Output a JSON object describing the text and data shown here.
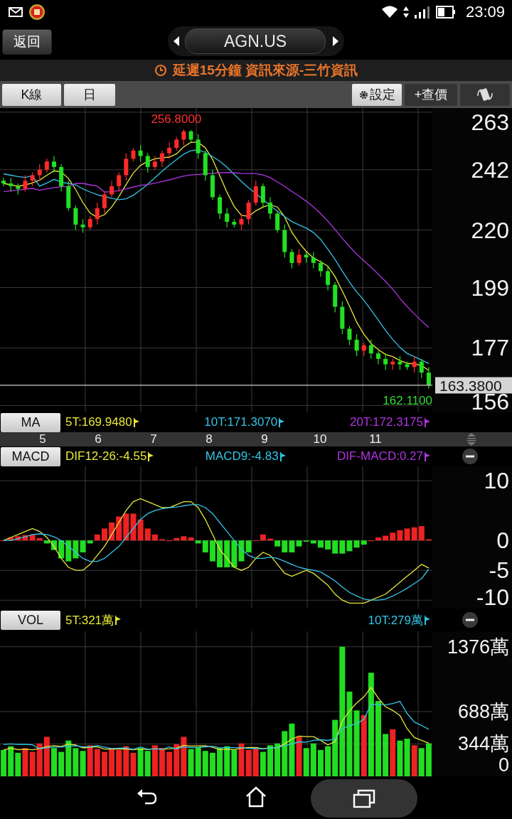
{
  "status_bar": {
    "time": "23:09"
  },
  "header": {
    "back_button": "返回",
    "symbol": "AGN.US"
  },
  "notice": "延遲15分鐘 資訊來源-三竹資訊",
  "toolbar": {
    "chips": [
      "K線",
      "日"
    ],
    "settings": "設定",
    "quote": "+查價"
  },
  "price_chart": {
    "high_label": "256.8000",
    "low_label": "162.1100",
    "chart_data": {
      "type": "candlestick",
      "ylim": [
        153.5,
        264.5
      ],
      "yticks": [
        263,
        242,
        220,
        199,
        177,
        156
      ],
      "grid": true,
      "ref_lines": [
        {
          "axis": "y",
          "value": 163.38,
          "label": "163.3800"
        }
      ],
      "ohlc": [
        [
          238,
          239,
          236,
          237
        ],
        [
          237,
          239,
          234,
          236
        ],
        [
          236,
          237,
          233,
          235
        ],
        [
          235,
          240,
          234,
          238
        ],
        [
          238,
          241,
          236,
          240
        ],
        [
          240,
          244,
          238,
          242
        ],
        [
          242,
          246,
          241,
          245
        ],
        [
          245,
          247,
          241,
          243
        ],
        [
          243,
          244,
          234,
          236
        ],
        [
          236,
          238,
          227,
          228
        ],
        [
          228,
          229,
          220,
          222
        ],
        [
          222,
          224,
          219,
          221
        ],
        [
          221,
          225,
          220,
          224
        ],
        [
          224,
          230,
          222,
          228
        ],
        [
          228,
          234,
          226,
          233
        ],
        [
          233,
          238,
          232,
          236
        ],
        [
          236,
          241,
          234,
          240
        ],
        [
          240,
          248,
          238,
          246
        ],
        [
          246,
          250,
          245,
          249
        ],
        [
          249,
          251,
          245,
          247
        ],
        [
          247,
          248,
          241,
          243
        ],
        [
          243,
          247,
          242,
          245
        ],
        [
          245,
          249,
          243,
          248
        ],
        [
          248,
          252,
          246,
          250
        ],
        [
          250,
          254,
          249,
          253
        ],
        [
          253,
          256.8,
          251,
          256
        ],
        [
          256,
          256.5,
          252,
          253
        ],
        [
          253,
          255,
          246,
          248
        ],
        [
          248,
          249,
          238,
          240
        ],
        [
          240,
          242,
          231,
          232
        ],
        [
          232,
          233,
          224,
          226
        ],
        [
          226,
          228,
          221,
          223
        ],
        [
          223,
          224,
          221,
          222
        ],
        [
          222,
          226,
          220,
          224
        ],
        [
          224,
          231,
          222,
          230
        ],
        [
          230,
          238,
          229,
          236
        ],
        [
          236,
          237,
          228,
          230
        ],
        [
          230,
          232,
          224,
          226
        ],
        [
          226,
          227,
          219,
          220
        ],
        [
          220,
          222,
          210,
          212
        ],
        [
          212,
          213,
          206,
          208
        ],
        [
          208,
          213,
          207,
          211
        ],
        [
          211,
          212,
          208,
          210
        ],
        [
          210,
          212,
          206,
          208
        ],
        [
          208,
          209,
          203,
          205
        ],
        [
          205,
          207,
          198,
          200
        ],
        [
          200,
          201,
          190,
          192
        ],
        [
          192,
          194,
          182,
          184
        ],
        [
          184,
          185,
          178,
          180
        ],
        [
          180,
          182,
          174,
          176
        ],
        [
          176,
          179,
          174,
          178
        ],
        [
          178,
          180,
          173,
          175
        ],
        [
          175,
          176,
          171,
          173
        ],
        [
          173,
          175,
          169,
          171
        ],
        [
          171,
          173,
          169,
          172
        ],
        [
          172,
          174,
          169,
          171
        ],
        [
          171,
          172,
          169,
          170
        ],
        [
          170,
          174,
          168,
          172
        ],
        [
          172,
          173,
          166,
          168
        ],
        [
          168,
          170,
          162.11,
          163.38
        ]
      ],
      "series": [
        {
          "name": "5T",
          "type": "line",
          "color": "#e8e83a",
          "values": [
            237,
            236.5,
            236,
            236.5,
            237.2,
            238.2,
            240,
            241.6,
            241.2,
            238.8,
            234.8,
            230,
            226.2,
            224.6,
            225.6,
            228.4,
            232.2,
            236.6,
            240.8,
            243.6,
            245,
            246,
            246.4,
            246.6,
            247.8,
            250.4,
            252,
            252,
            250,
            245.8,
            239.8,
            233.8,
            228.6,
            225.4,
            225,
            227,
            228.4,
            229.2,
            228.4,
            224.8,
            219.2,
            215.4,
            212.2,
            209.8,
            208.4,
            206.8,
            203,
            197.8,
            192.2,
            186.4,
            182,
            178.6,
            176.4,
            174.6,
            173.8,
            172.4,
            171.4,
            171.2,
            170.6,
            168.8
          ]
        },
        {
          "name": "10T",
          "type": "line",
          "color": "#33c4e6",
          "values": [
            240.5,
            240,
            239.5,
            239.2,
            239.8,
            236,
            237.2,
            238.5,
            237.5,
            237,
            236.5,
            235,
            233.9,
            232.9,
            232.2,
            231.6,
            231.1,
            231.4,
            232.7,
            234.6,
            236.7,
            239.1,
            241.5,
            243.7,
            245.7,
            247.7,
            249,
            249.2,
            248.3,
            246.8,
            245.1,
            242.9,
            240.3,
            237.7,
            235.4,
            233.4,
            231.1,
            228.9,
            226.9,
            224.9,
            223.1,
            221.9,
            220.7,
            219.1,
            216.6,
            213,
            209.2,
            205,
            201,
            197.4,
            194.4,
            190.8,
            187.1,
            183.4,
            180.1,
            177.2,
            175,
            173.8,
            172.6,
            171.3
          ]
        },
        {
          "name": "20T",
          "type": "line",
          "color": "#b034e0",
          "values": [
            234,
            234.3,
            234.6,
            234.9,
            235.2,
            234.5,
            235,
            235.5,
            235.8,
            235.9,
            237,
            237,
            236.5,
            236,
            233.9,
            234,
            234.4,
            235,
            235.7,
            236.3,
            236.6,
            237.1,
            237.7,
            238.3,
            239,
            239.7,
            240.1,
            240.3,
            240.5,
            240.7,
            240.9,
            241,
            240.9,
            240.7,
            240.6,
            240.6,
            240.1,
            239.1,
            237.6,
            235.9,
            234.1,
            232.4,
            230.5,
            228.4,
            226,
            223.2,
            220.2,
            217,
            214,
            211.2,
            208.8,
            206.4,
            203.9,
            201.3,
            198.4,
            195.1,
            192.1,
            189.4,
            186.8,
            184.5
          ]
        }
      ]
    }
  },
  "ma_legend": {
    "button": "MA",
    "values": [
      ":169.9480",
      ":171.3070",
      ":172.3175"
    ]
  },
  "date_axis": [
    "5",
    "6",
    "7",
    "8",
    "9",
    "10",
    "11"
  ],
  "macd": {
    "button": "MACD",
    "legend": [
      {
        "value": ":-4.55"
      },
      {
        "value": ":-4.83"
      },
      {
        "value": ":0.27",
        "color": "#b034e0"
      }
    ],
    "chart_data": {
      "type": "line",
      "ylim": [
        -11.4,
        12.4
      ],
      "yticks": [
        10,
        0,
        -5,
        -10
      ],
      "grid": true,
      "series": [
        {
          "name": "DIF12-26",
          "color": "#e8e83a",
          "values": [
            0,
            0.5,
            1,
            1.5,
            2,
            1.5,
            0.5,
            -1,
            -3,
            -4.5,
            -5,
            -5,
            -4,
            -2.5,
            -1,
            1,
            3,
            5,
            6.5,
            7,
            6.5,
            6,
            5.5,
            5.5,
            6,
            6.5,
            6.5,
            5.5,
            3.5,
            1,
            -1.5,
            -3,
            -4.5,
            -5,
            -4.5,
            -3,
            -2,
            -2.5,
            -4,
            -5.5,
            -6,
            -5.5,
            -5,
            -5.5,
            -6.5,
            -7.5,
            -9,
            -10,
            -10.5,
            -10.5,
            -10.5,
            -10,
            -9.5,
            -9,
            -8,
            -7,
            -6,
            -5,
            -4,
            -4.6
          ]
        },
        {
          "name": "MACD9",
          "color": "#33c4e6",
          "values": [
            0,
            0,
            0.3,
            0.6,
            1,
            1.1,
            1,
            0.6,
            0,
            -1,
            -2,
            -3,
            -3.5,
            -3.5,
            -3,
            -2,
            -1,
            0.5,
            2,
            3.5,
            4.5,
            5,
            5.3,
            5.5,
            5.6,
            5.8,
            6,
            6,
            5.5,
            4.5,
            3,
            1.5,
            0,
            -1.5,
            -2.5,
            -3,
            -3,
            -2.8,
            -3,
            -3.5,
            -4,
            -4.5,
            -4.8,
            -5,
            -5.3,
            -6,
            -6.8,
            -7.8,
            -8.7,
            -9.3,
            -9.8,
            -10,
            -10,
            -9.8,
            -9.3,
            -8.7,
            -8,
            -7.2,
            -6.4,
            -4.8
          ]
        },
        {
          "name": "DIF-MACD",
          "type": "bar",
          "values": [
            0,
            0.5,
            0.7,
            0.9,
            1,
            0.4,
            -0.5,
            -1.6,
            -3,
            -3.5,
            -3,
            -2,
            -0.5,
            1,
            2,
            3,
            4,
            4.5,
            4.5,
            3.5,
            2,
            1,
            0.2,
            0,
            0.4,
            0.7,
            0.5,
            -0.5,
            -2,
            -3.5,
            -4.5,
            -4.5,
            -4.5,
            -3.5,
            -2,
            0,
            1,
            0.3,
            -1,
            -2,
            -2,
            -1,
            -0.2,
            -0.5,
            -1.2,
            -1.5,
            -2.2,
            -2.2,
            -1.8,
            -1.2,
            -0.7,
            0,
            0.5,
            0.8,
            1.3,
            1.7,
            2,
            2.2,
            2.4,
            0.2
          ],
          "colors": [
            "#ee2222",
            "#ee2222",
            "#ee2222",
            "#ee2222",
            "#ee2222",
            "#ee2222",
            "#22dd22",
            "#22dd22",
            "#22dd22",
            "#22dd22",
            "#22dd22",
            "#22dd22",
            "#22dd22",
            "#ee2222",
            "#ee2222",
            "#ee2222",
            "#ee2222",
            "#ee2222",
            "#ee2222",
            "#ee2222",
            "#ee2222",
            "#ee2222",
            "#ee2222",
            "#ee2222",
            "#ee2222",
            "#ee2222",
            "#ee2222",
            "#22dd22",
            "#22dd22",
            "#22dd22",
            "#22dd22",
            "#22dd22",
            "#22dd22",
            "#22dd22",
            "#22dd22",
            "#ee2222",
            "#ee2222",
            "#ee2222",
            "#22dd22",
            "#22dd22",
            "#22dd22",
            "#22dd22",
            "#22dd22",
            "#22dd22",
            "#22dd22",
            "#22dd22",
            "#22dd22",
            "#22dd22",
            "#22dd22",
            "#22dd22",
            "#22dd22",
            "#ee2222",
            "#ee2222",
            "#ee2222",
            "#ee2222",
            "#ee2222",
            "#ee2222",
            "#ee2222",
            "#ee2222",
            "#ee2222"
          ]
        }
      ]
    }
  },
  "volume": {
    "values": [
      ":321萬",
      ":279萬"
    ],
    "chart_data": {
      "type": "bar",
      "ylim": [
        0,
        1540
      ],
      "yticks": [
        {
          "value": 1376,
          "label": "1376萬"
        },
        {
          "value": 688,
          "label": "688萬"
        },
        {
          "value": 344,
          "label": "344萬"
        },
        0
      ],
      "grid": true,
      "series": [
        {
          "name": "VOL",
          "values": [
            280,
            320,
            250,
            300,
            260,
            350,
            420,
            300,
            260,
            380,
            300,
            270,
            330,
            290,
            260,
            300,
            280,
            320,
            250,
            300,
            270,
            330,
            300,
            260,
            340,
            420,
            290,
            310,
            270,
            250,
            300,
            320,
            280,
            350,
            280,
            300,
            260,
            330,
            350,
            480,
            560,
            420,
            300,
            350,
            280,
            320,
            600,
            1376,
            900,
            700,
            650,
            1100,
            800,
            450,
            500,
            380,
            400,
            330,
            300,
            350
          ],
          "colors": [
            "#22dd22",
            "#22dd22",
            "#22dd22",
            "#ee2222",
            "#ee2222",
            "#ee2222",
            "#ee2222",
            "#22dd22",
            "#22dd22",
            "#22dd22",
            "#22dd22",
            "#22dd22",
            "#ee2222",
            "#ee2222",
            "#ee2222",
            "#ee2222",
            "#ee2222",
            "#ee2222",
            "#ee2222",
            "#22dd22",
            "#22dd22",
            "#ee2222",
            "#ee2222",
            "#ee2222",
            "#ee2222",
            "#ee2222",
            "#22dd22",
            "#22dd22",
            "#22dd22",
            "#22dd22",
            "#22dd22",
            "#22dd22",
            "#22dd22",
            "#ee2222",
            "#ee2222",
            "#ee2222",
            "#22dd22",
            "#22dd22",
            "#22dd22",
            "#22dd22",
            "#22dd22",
            "#ee2222",
            "#22dd22",
            "#22dd22",
            "#22dd22",
            "#22dd22",
            "#22dd22",
            "#22dd22",
            "#22dd22",
            "#22dd22",
            "#ee2222",
            "#22dd22",
            "#22dd22",
            "#22dd22",
            "#ee2222",
            "#22dd22",
            "#22dd22",
            "#ee2222",
            "#22dd22",
            "#22dd22"
          ]
        },
        {
          "name": "5T",
          "type": "line",
          "color": "#e8e83a",
          "values": [
            280,
            300,
            283,
            288,
            282,
            296,
            316,
            326,
            318,
            342,
            332,
            302,
            308,
            314,
            290,
            290,
            292,
            290,
            282,
            290,
            284,
            294,
            290,
            292,
            300,
            330,
            322,
            324,
            326,
            308,
            284,
            290,
            284,
            300,
            306,
            306,
            294,
            304,
            304,
            344,
            396,
            428,
            422,
            422,
            382,
            334,
            370,
            585,
            695,
            779,
            845,
            945,
            830,
            740,
            700,
            646,
            506,
            412,
            382,
            352
          ]
        },
        {
          "name": "10T",
          "type": "line",
          "color": "#33c4e6",
          "values": [
            340,
            345,
            340,
            340,
            335,
            292,
            303,
            310,
            310,
            319,
            324,
            314,
            313,
            328,
            311,
            296,
            300,
            302,
            286,
            312,
            288,
            292,
            286,
            312,
            292,
            312,
            306,
            308,
            313,
            319,
            303,
            307,
            305,
            304,
            295,
            298,
            289,
            302,
            305,
            325,
            345,
            366,
            363,
            383,
            389,
            381,
            396,
            504,
            539,
            557,
            608,
            765,
            763,
            760,
            773,
            796,
            668,
            576,
            541,
            499
          ]
        }
      ]
    }
  }
}
